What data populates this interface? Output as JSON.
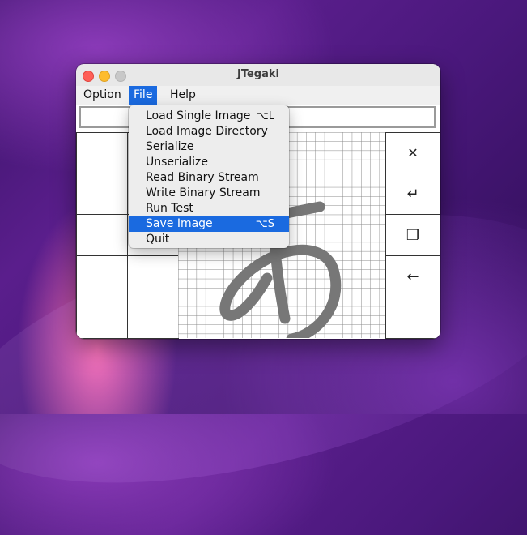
{
  "window": {
    "title": "JTegaki"
  },
  "menubar": {
    "items": [
      "Option",
      "File",
      "Help"
    ],
    "active": "File"
  },
  "text_field": {
    "value": ""
  },
  "canvas": {
    "glyph": "あ",
    "glyph_color": "#777777"
  },
  "right_buttons": [
    {
      "name": "clear-button",
      "icon": "✕"
    },
    {
      "name": "undo-button",
      "icon": "↵"
    },
    {
      "name": "copy-button",
      "icon": "❐"
    },
    {
      "name": "backspace-button",
      "icon": "←"
    }
  ],
  "file_menu": {
    "items": [
      {
        "label": "Load Single Image",
        "shortcut": "⌥L"
      },
      {
        "label": "Load Image Directory",
        "shortcut": ""
      },
      {
        "label": "Serialize",
        "shortcut": ""
      },
      {
        "label": "Unserialize",
        "shortcut": ""
      },
      {
        "label": "Read Binary Stream",
        "shortcut": ""
      },
      {
        "label": "Write Binary Stream",
        "shortcut": ""
      },
      {
        "label": "Run Test",
        "shortcut": ""
      },
      {
        "label": "Save Image",
        "shortcut": "⌥S",
        "selected": true
      },
      {
        "label": "Quit",
        "shortcut": ""
      }
    ]
  },
  "colors": {
    "accent": "#1a6ae0",
    "menu_bg": "#ededed"
  }
}
